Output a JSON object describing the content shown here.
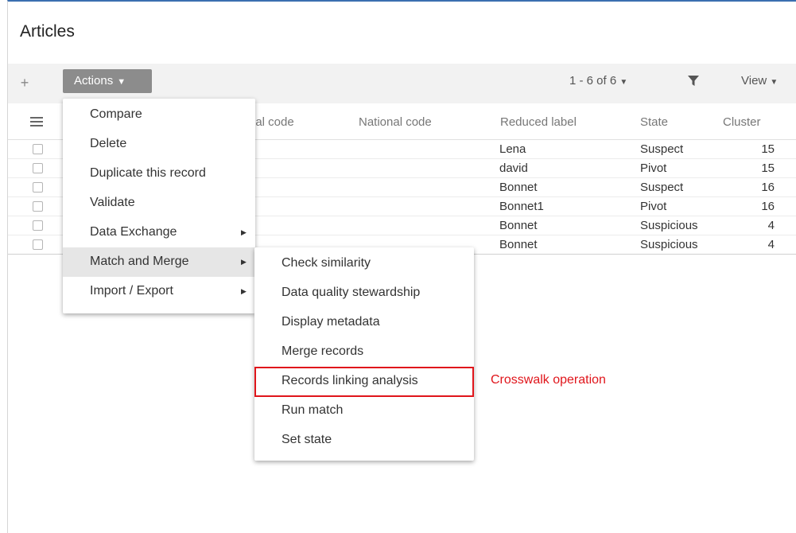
{
  "page": {
    "title": "Articles"
  },
  "toolbar": {
    "add_label": "+",
    "actions_label": "Actions",
    "pager_label": "1 - 6 of 6",
    "view_label": "View"
  },
  "columns": [
    "nal code",
    "National code",
    "Reduced label",
    "State",
    "Cluster"
  ],
  "rows": [
    {
      "reduced_label": "Lena",
      "state": "Suspect",
      "cluster": "15"
    },
    {
      "reduced_label": "david",
      "state": "Pivot",
      "cluster": "15"
    },
    {
      "reduced_label": "Bonnet",
      "state": "Suspect",
      "cluster": "16"
    },
    {
      "reduced_label": "Bonnet1",
      "state": "Pivot",
      "cluster": "16"
    },
    {
      "reduced_label": "Bonnet",
      "state": "Suspicious",
      "cluster": "4"
    },
    {
      "reduced_label": "Bonnet",
      "state": "Suspicious",
      "cluster": "4"
    }
  ],
  "actions_menu": [
    {
      "label": "Compare",
      "has_submenu": false
    },
    {
      "label": "Delete",
      "has_submenu": false
    },
    {
      "label": "Duplicate this record",
      "has_submenu": false
    },
    {
      "label": "Validate",
      "has_submenu": false
    },
    {
      "label": "Data Exchange",
      "has_submenu": true
    },
    {
      "label": "Match and Merge",
      "has_submenu": true
    },
    {
      "label": "Import / Export",
      "has_submenu": true
    }
  ],
  "submenu": [
    {
      "label": "Check similarity"
    },
    {
      "label": "Data quality stewardship"
    },
    {
      "label": "Display metadata"
    },
    {
      "label": "Merge records"
    },
    {
      "label": "Records linking analysis"
    },
    {
      "label": "Run match"
    },
    {
      "label": "Set state"
    }
  ],
  "annotation": {
    "text": "Crosswalk operation",
    "color": "#e0151b"
  },
  "colors": {
    "actions_button": "#8c8c8c",
    "toolbar_bg": "#f2f2f2",
    "accent_border": "#3a6fb0"
  }
}
